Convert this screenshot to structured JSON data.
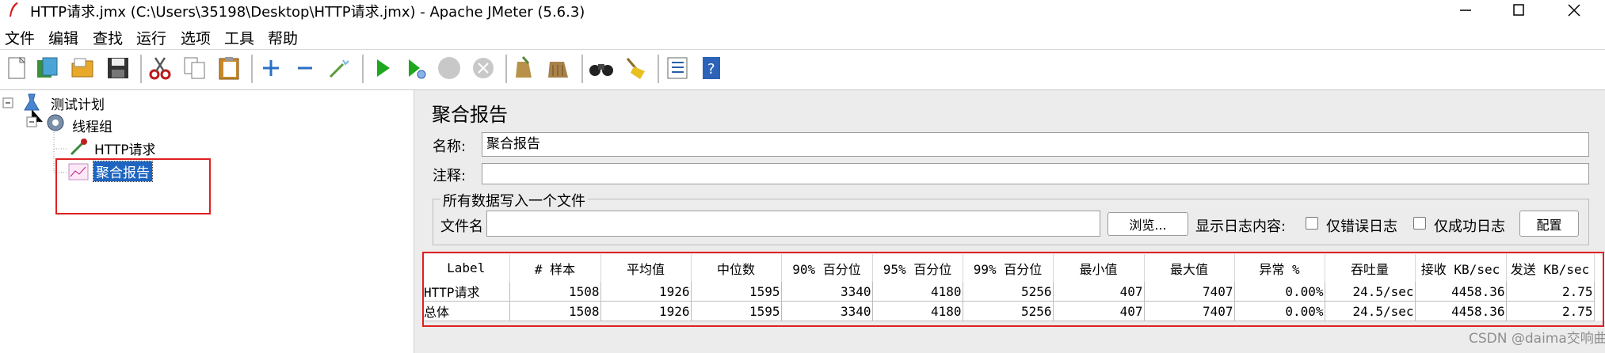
{
  "window": {
    "title": "HTTP请求.jmx (C:\\Users\\35198\\Desktop\\HTTP请求.jmx) - Apache JMeter (5.6.3)"
  },
  "menu": [
    "文件",
    "编辑",
    "查找",
    "运行",
    "选项",
    "工具",
    "帮助"
  ],
  "tree": {
    "test_plan": "测试计划",
    "thread_group": "线程组",
    "http_request": "HTTP请求",
    "aggregate_report": "聚合报告"
  },
  "panel": {
    "title": "聚合报告",
    "name_label": "名称:",
    "name_value": "聚合报告",
    "comment_label": "注释:",
    "comment_value": "",
    "file_group_title": "所有数据写入一个文件",
    "filename_label": "文件名",
    "filename_value": "",
    "browse_button": "浏览...",
    "log_content_label": "显示日志内容:",
    "errors_only_label": "仅错误日志",
    "success_only_label": "仅成功日志",
    "config_button": "配置"
  },
  "table": {
    "headers": [
      "Label",
      "# 样本",
      "平均值",
      "中位数",
      "90% 百分位",
      "95% 百分位",
      "99% 百分位",
      "最小值",
      "最大值",
      "异常 %",
      "吞吐量",
      "接收 KB/sec",
      "发送 KB/sec"
    ],
    "rows": [
      [
        "HTTP请求",
        "1508",
        "1926",
        "1595",
        "3340",
        "4180",
        "5256",
        "407",
        "7407",
        "0.00%",
        "24.5/sec",
        "4458.36",
        "2.75"
      ],
      [
        "总体",
        "1508",
        "1926",
        "1595",
        "3340",
        "4180",
        "5256",
        "407",
        "7407",
        "0.00%",
        "24.5/sec",
        "4458.36",
        "2.75"
      ]
    ]
  },
  "watermark": "CSDN @daima交响曲",
  "colors": {
    "selection": "#1d65c1",
    "highlight_box": "#e02020",
    "panel_bg": "#ececec"
  }
}
